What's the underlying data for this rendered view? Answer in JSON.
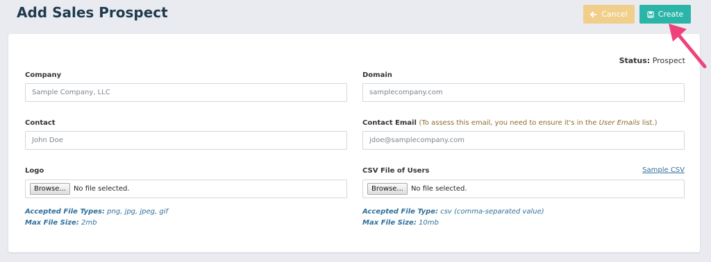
{
  "header": {
    "title": "Add Sales Prospect",
    "cancel_label": "Cancel",
    "create_label": "Create"
  },
  "status": {
    "label": "Status:",
    "value": "Prospect"
  },
  "form": {
    "company": {
      "label": "Company",
      "placeholder": "Sample Company, LLC"
    },
    "domain": {
      "label": "Domain",
      "placeholder": "samplecompany.com"
    },
    "contact": {
      "label": "Contact",
      "placeholder": "John Doe"
    },
    "contact_email": {
      "label": "Contact Email",
      "note_prefix": "(To assess this email, you need to ensure it's in the",
      "note_link": "User Emails",
      "note_suffix": "list.)",
      "placeholder": "jdoe@samplecompany.com"
    },
    "logo": {
      "label": "Logo",
      "browse_label": "Browse...",
      "file_status": "No file selected.",
      "types_label": "Accepted File Types:",
      "types_value": "png, jpg, jpeg, gif",
      "size_label": "Max File Size:",
      "size_value": "2mb"
    },
    "csv": {
      "label": "CSV File of Users",
      "sample_link": "Sample CSV",
      "browse_label": "Browse...",
      "file_status": "No file selected.",
      "type_label": "Accepted File Type:",
      "type_value": "csv (comma-separated value)",
      "size_label": "Max File Size:",
      "size_value": "10mb"
    }
  },
  "colors": {
    "cancel": "#f0cf8a",
    "create": "#2bb4a8",
    "arrow": "#f0427a",
    "title": "#1f3a4d"
  }
}
